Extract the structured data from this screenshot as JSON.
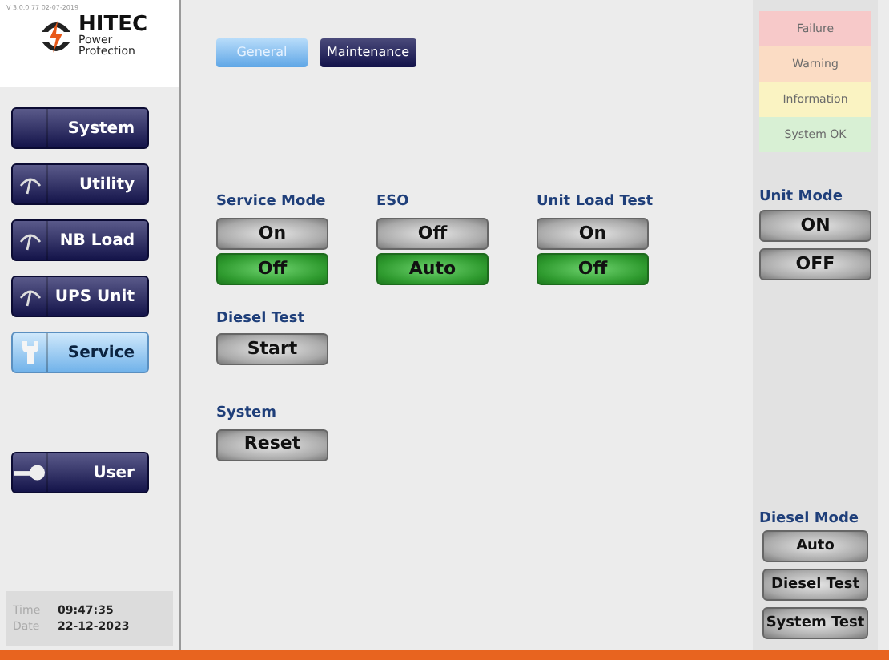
{
  "version": "V 3.0.0.77 02-07-2019",
  "logo": {
    "name": "HITEC",
    "tagline_1": "Power",
    "tagline_2": "Protection"
  },
  "sidebar": {
    "items": [
      {
        "label": "System",
        "kind": "blank",
        "selected": false
      },
      {
        "label": "Utility",
        "kind": "gauge",
        "selected": false
      },
      {
        "label": "NB Load",
        "kind": "gauge",
        "selected": false
      },
      {
        "label": "UPS Unit",
        "kind": "gauge",
        "selected": false
      },
      {
        "label": "Service",
        "kind": "wrench",
        "selected": true
      },
      {
        "label": "User",
        "kind": "key",
        "selected": false
      }
    ]
  },
  "clock": {
    "time_label": "Time",
    "time": "09:47:35",
    "date_label": "Date",
    "date": "22-12-2023"
  },
  "tabs": [
    {
      "label": "General",
      "selected": true
    },
    {
      "label": "Maintenance",
      "selected": false
    }
  ],
  "controls": [
    {
      "title": "Service Mode",
      "buttons": [
        {
          "label": "On",
          "selected": false
        },
        {
          "label": "Off",
          "selected": true
        }
      ]
    },
    {
      "title": "ESO",
      "buttons": [
        {
          "label": "Off",
          "selected": false
        },
        {
          "label": "Auto",
          "selected": true
        }
      ]
    },
    {
      "title": "Unit Load Test",
      "buttons": [
        {
          "label": "On",
          "selected": false
        },
        {
          "label": "Off",
          "selected": true
        }
      ]
    }
  ],
  "actions": [
    {
      "title": "Diesel Test",
      "button": "Start"
    },
    {
      "title": "System",
      "button": "Reset"
    }
  ],
  "alarms": [
    {
      "label": "Failure",
      "color": "#f7c9c9"
    },
    {
      "label": "Warning",
      "color": "#fbdcc4"
    },
    {
      "label": "Information",
      "color": "#faf3c2"
    },
    {
      "label": "System OK",
      "color": "#d8f0d4"
    }
  ],
  "unit_mode": {
    "title": "Unit Mode",
    "buttons": [
      {
        "label": "ON",
        "selected": false
      },
      {
        "label": "OFF",
        "selected": false
      }
    ]
  },
  "diesel_mode": {
    "title": "Diesel Mode",
    "buttons": [
      {
        "label": "Auto",
        "selected": false
      },
      {
        "label": "Diesel Test",
        "selected": false
      },
      {
        "label": "System Test",
        "selected": false
      }
    ]
  }
}
